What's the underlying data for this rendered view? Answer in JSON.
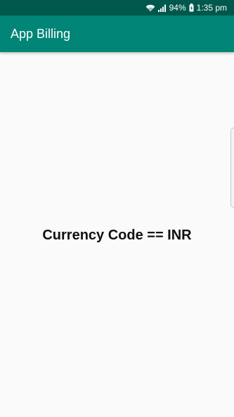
{
  "status_bar": {
    "icons": [
      "wifi-icon",
      "signal-icon",
      "battery-icon"
    ],
    "battery_percent": "94%",
    "time": "1:35 pm",
    "background_color": "#00574b"
  },
  "app_bar": {
    "title": "App Billing",
    "background_color": "#008577"
  },
  "main": {
    "message": "Currency Code == INR"
  }
}
